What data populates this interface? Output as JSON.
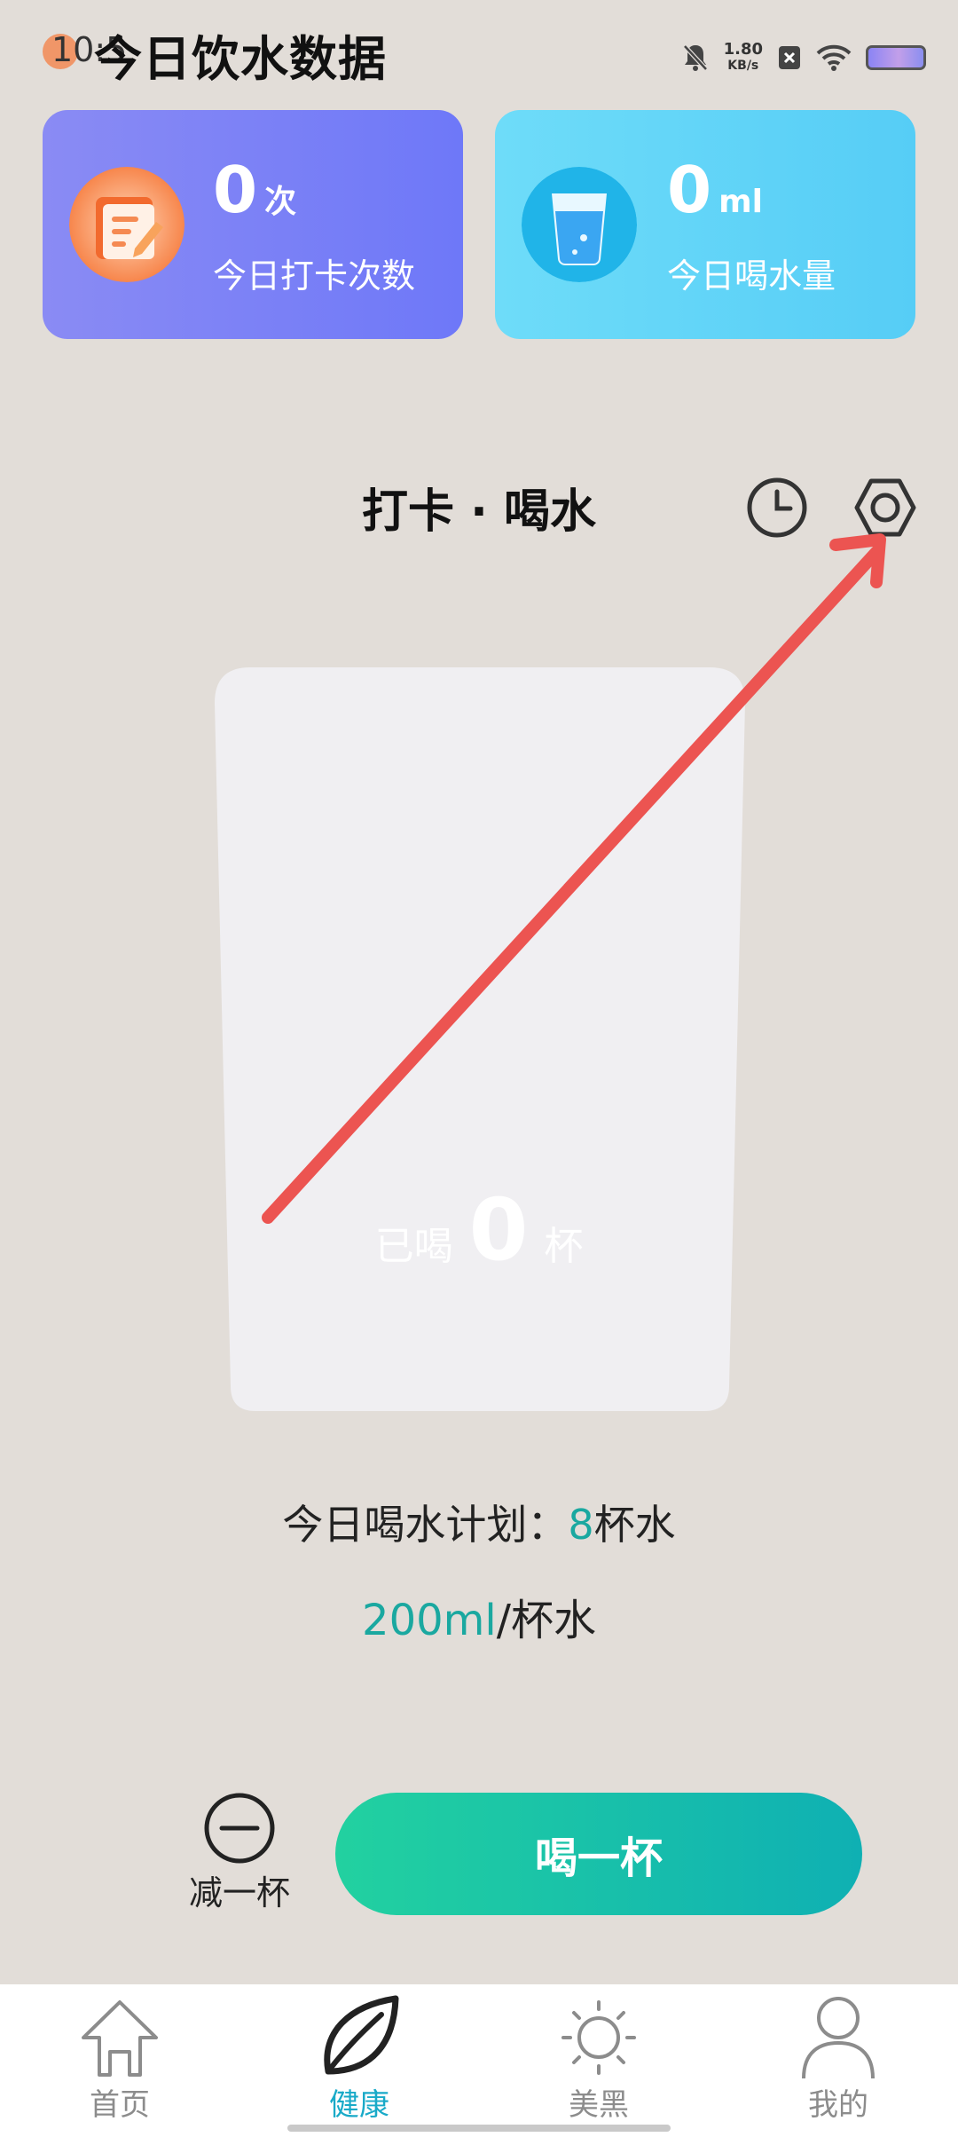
{
  "status_bar": {
    "time": "10:5",
    "net_speed_value": "1.80",
    "net_speed_unit": "KB/s"
  },
  "page_title": "今日饮水数据",
  "cards": {
    "checkins": {
      "value": "0",
      "unit": "次",
      "label": "今日打卡次数",
      "icon": "notepad-icon"
    },
    "water": {
      "value": "0",
      "unit": "ml",
      "label": "今日喝水量",
      "icon": "water-glass-icon"
    }
  },
  "section": {
    "title": "打卡 · 喝水",
    "history_icon": "clock-icon",
    "settings_icon": "hexagon-settings-icon"
  },
  "cup": {
    "prefix": "已喝",
    "count": "0",
    "suffix": "杯"
  },
  "plan": {
    "label": "今日喝水计划：",
    "cups": "8",
    "unit": "杯水"
  },
  "per_cup": {
    "amount": "200ml",
    "unit": "/杯水"
  },
  "controls": {
    "minus_label": "减一杯",
    "drink_label": "喝一杯"
  },
  "nav": [
    {
      "label": "首页",
      "icon": "home-icon"
    },
    {
      "label": "健康",
      "icon": "leaf-icon"
    },
    {
      "label": "美黑",
      "icon": "sun-icon"
    },
    {
      "label": "我的",
      "icon": "person-icon"
    }
  ],
  "colors": {
    "accent_teal": "#1aa8a0",
    "nav_active": "#19aac8",
    "annotation_arrow": "#ec5451"
  }
}
